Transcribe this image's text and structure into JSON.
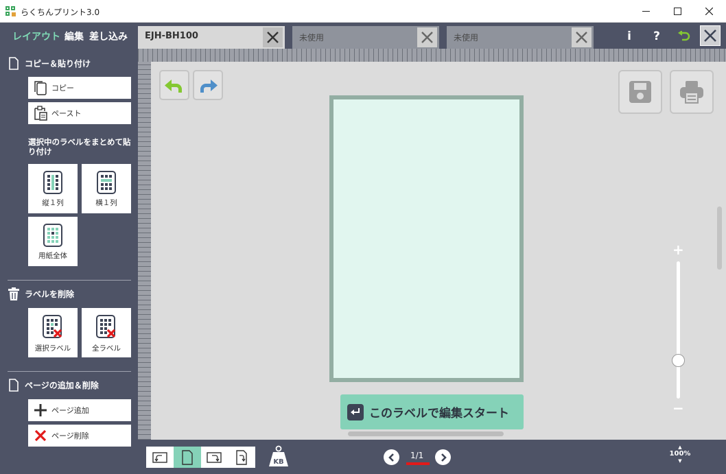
{
  "window": {
    "title": "らくちんプリント3.0",
    "minimize_icon": "minimize-icon",
    "maximize_icon": "maximize-icon",
    "close_icon": "close-icon"
  },
  "menu": {
    "tabs": [
      {
        "label": "レイアウト",
        "active": true
      },
      {
        "label": "編集",
        "active": false
      },
      {
        "label": "差し込み",
        "active": false
      }
    ]
  },
  "doc_tabs": [
    {
      "label": "EJH-BH100",
      "active": true
    },
    {
      "label": "未使用",
      "active": false
    },
    {
      "label": "未使用",
      "active": false
    }
  ],
  "top_icons": {
    "info": "i",
    "help": "?"
  },
  "sidebar": {
    "copy_paste": {
      "heading": "コピー＆貼り付け",
      "copy_label": "コピー",
      "paste_label": "ペースト",
      "group_caption": "選択中のラベルをまとめて貼り付け",
      "buttons": [
        {
          "label": "縦１列"
        },
        {
          "label": "横１列"
        },
        {
          "label": "用紙全体"
        }
      ]
    },
    "delete": {
      "heading": "ラベルを削除",
      "buttons": [
        {
          "label": "選択ラベル"
        },
        {
          "label": "全ラベル"
        }
      ]
    },
    "pages": {
      "heading": "ページの追加＆削除",
      "add_label": "ページ追加",
      "delete_label": "ページ削除"
    }
  },
  "canvas": {
    "start_label": "このラベルで編集スタート"
  },
  "zoom": {
    "plus": "+",
    "minus": "−",
    "level": "100%",
    "slider_fraction": 0.28
  },
  "pager": {
    "current": "1/1"
  },
  "colors": {
    "accent": "#85d2b8",
    "active_menu": "#7fd9b5",
    "dark_panel": "#4e5366",
    "paper_fill": "#e1f6ef",
    "page_indicator": "#e21a1a"
  }
}
